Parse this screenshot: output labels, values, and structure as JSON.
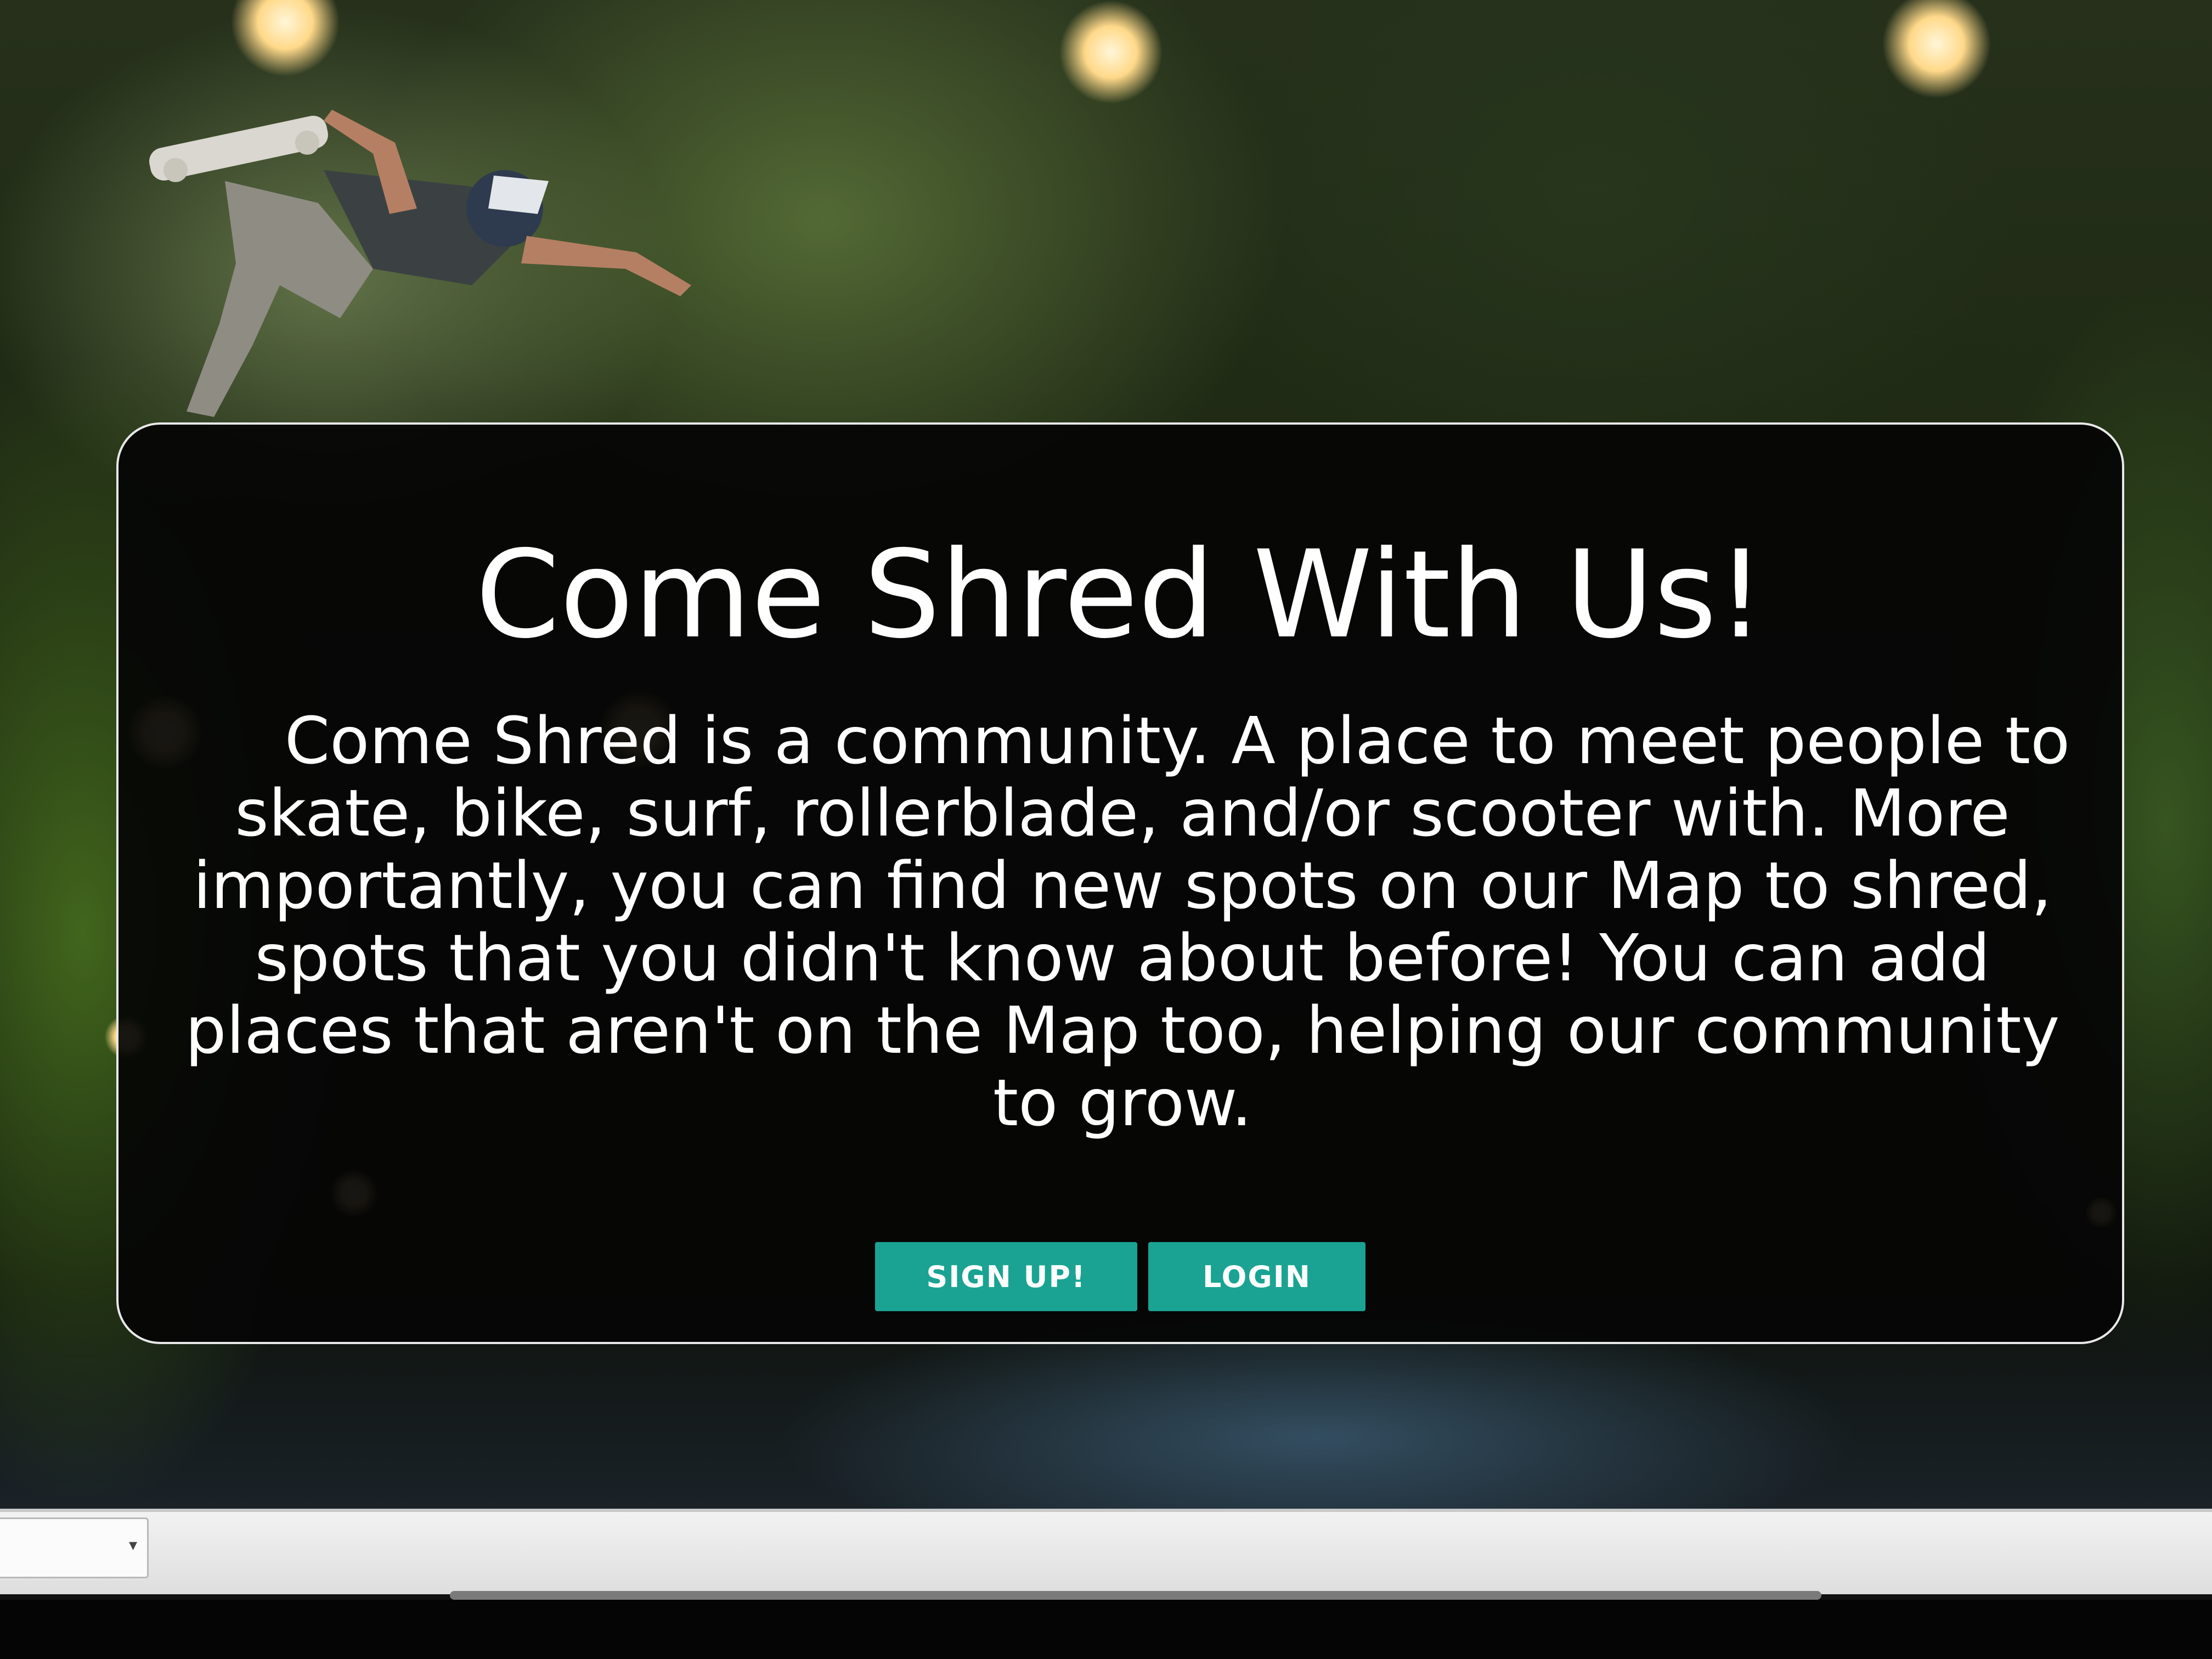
{
  "hero": {
    "title": "Come Shred With Us!",
    "description": "Come Shred is a community. A place to meet people to skate, bike, surf, rollerblade, and/or scooter with. More importantly, you can find new spots on our Map to shred, spots that you didn't know about before! You can add places that aren't on the Map too, helping our community to grow."
  },
  "actions": {
    "signup_label": "SIGN UP!",
    "login_label": "LOGIN"
  },
  "browser": {
    "select_arrow_icon": "chevron-down-icon"
  },
  "colors": {
    "button": "#1aa392",
    "card_background": "#050505",
    "card_border": "#e8e8e8",
    "text": "#ffffff"
  }
}
